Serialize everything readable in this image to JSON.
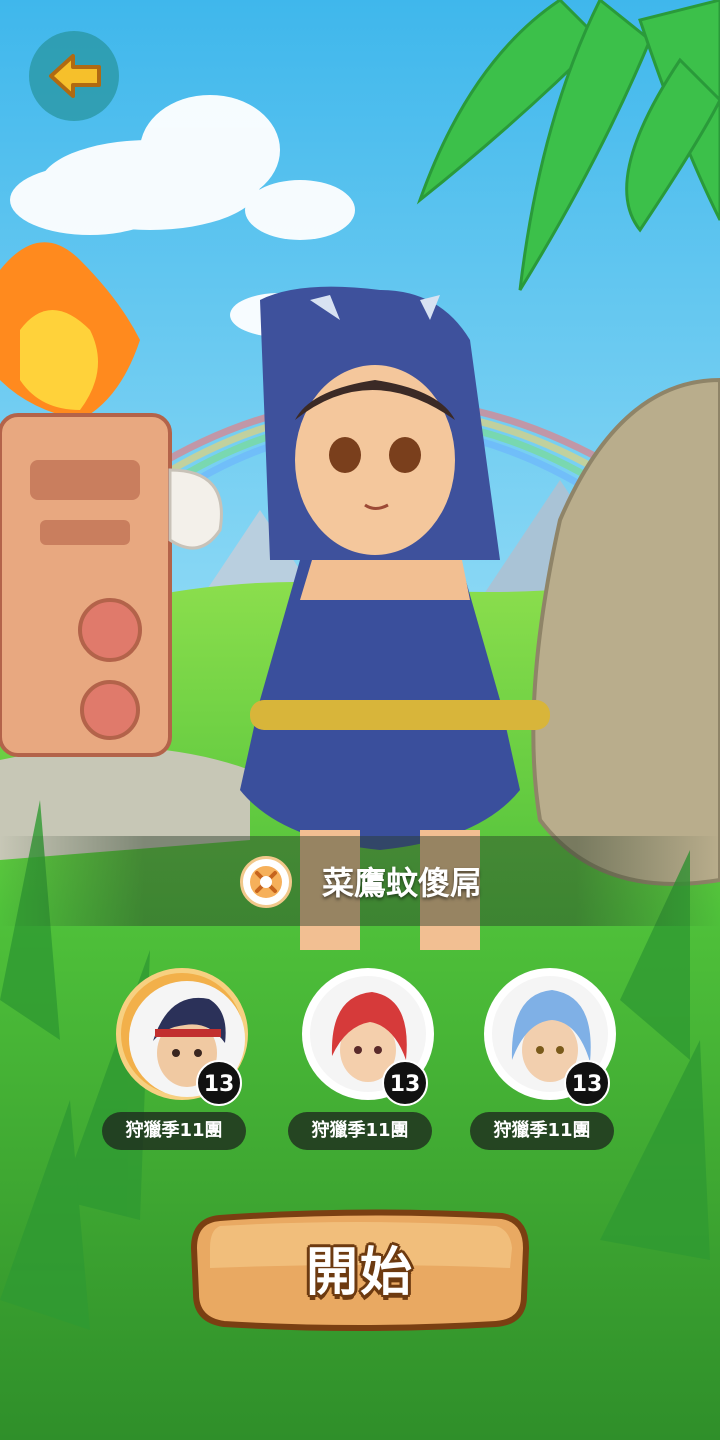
{
  "header": {
    "back_icon": "arrow-left-icon"
  },
  "player": {
    "name": "菜鷹蚊傻屌",
    "badge_icon": "crossed-hunt-emblem-icon"
  },
  "team": [
    {
      "label": "狩獵季11團",
      "level": "13",
      "selected": true,
      "hair_color": "#2b3159"
    },
    {
      "label": "狩獵季11團",
      "level": "13",
      "selected": false,
      "hair_color": "#d63a3a"
    },
    {
      "label": "狩獵季11團",
      "level": "13",
      "selected": false,
      "hair_color": "#7fb0e6"
    }
  ],
  "start_button": {
    "label": "開始"
  },
  "colors": {
    "accent": "#f2b04a",
    "button_fill": "#e9a962",
    "button_outline": "#6d3a10",
    "sky": "#5fc6ef",
    "grass": "#58c93c"
  }
}
